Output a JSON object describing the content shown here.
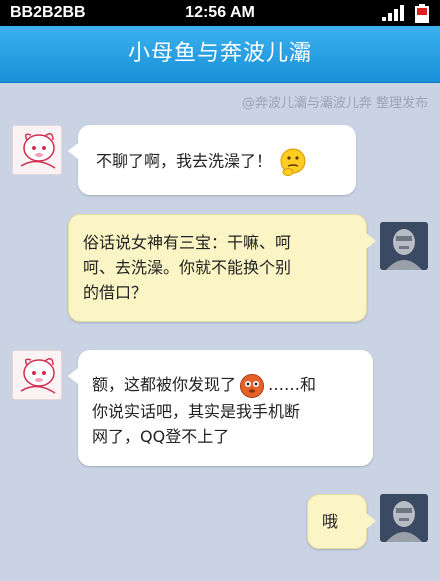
{
  "status_bar": {
    "carrier": "BB2B2BB",
    "time": "12:56 AM"
  },
  "title_bar": {
    "title": "小母鱼与奔波儿灞"
  },
  "watermark": "@奔波儿灞与灞波儿奔 整理发布",
  "messages": [
    {
      "sender": "left",
      "text": "不聊了啊，我去洗澡了！",
      "emoji": "thinking-face"
    },
    {
      "sender": "right",
      "lines": [
        "俗话说女神有三宝：干嘛、呵",
        "呵、去洗澡。你就不能换个别",
        "的借口？"
      ]
    },
    {
      "sender": "left",
      "line1": "额，这都被你发现了",
      "emoji": "embarrassed-face",
      "line1_tail": "……和",
      "line2": "你说实话吧，其实是我手机断",
      "line3": "网了，QQ登不上了"
    },
    {
      "sender": "right",
      "text": "哦"
    }
  ],
  "colors": {
    "title_bar": "#1a8fd9",
    "background": "#c9d3e3",
    "bubble_out": "#fbf4c4",
    "bubble_in": "#ffffff"
  }
}
